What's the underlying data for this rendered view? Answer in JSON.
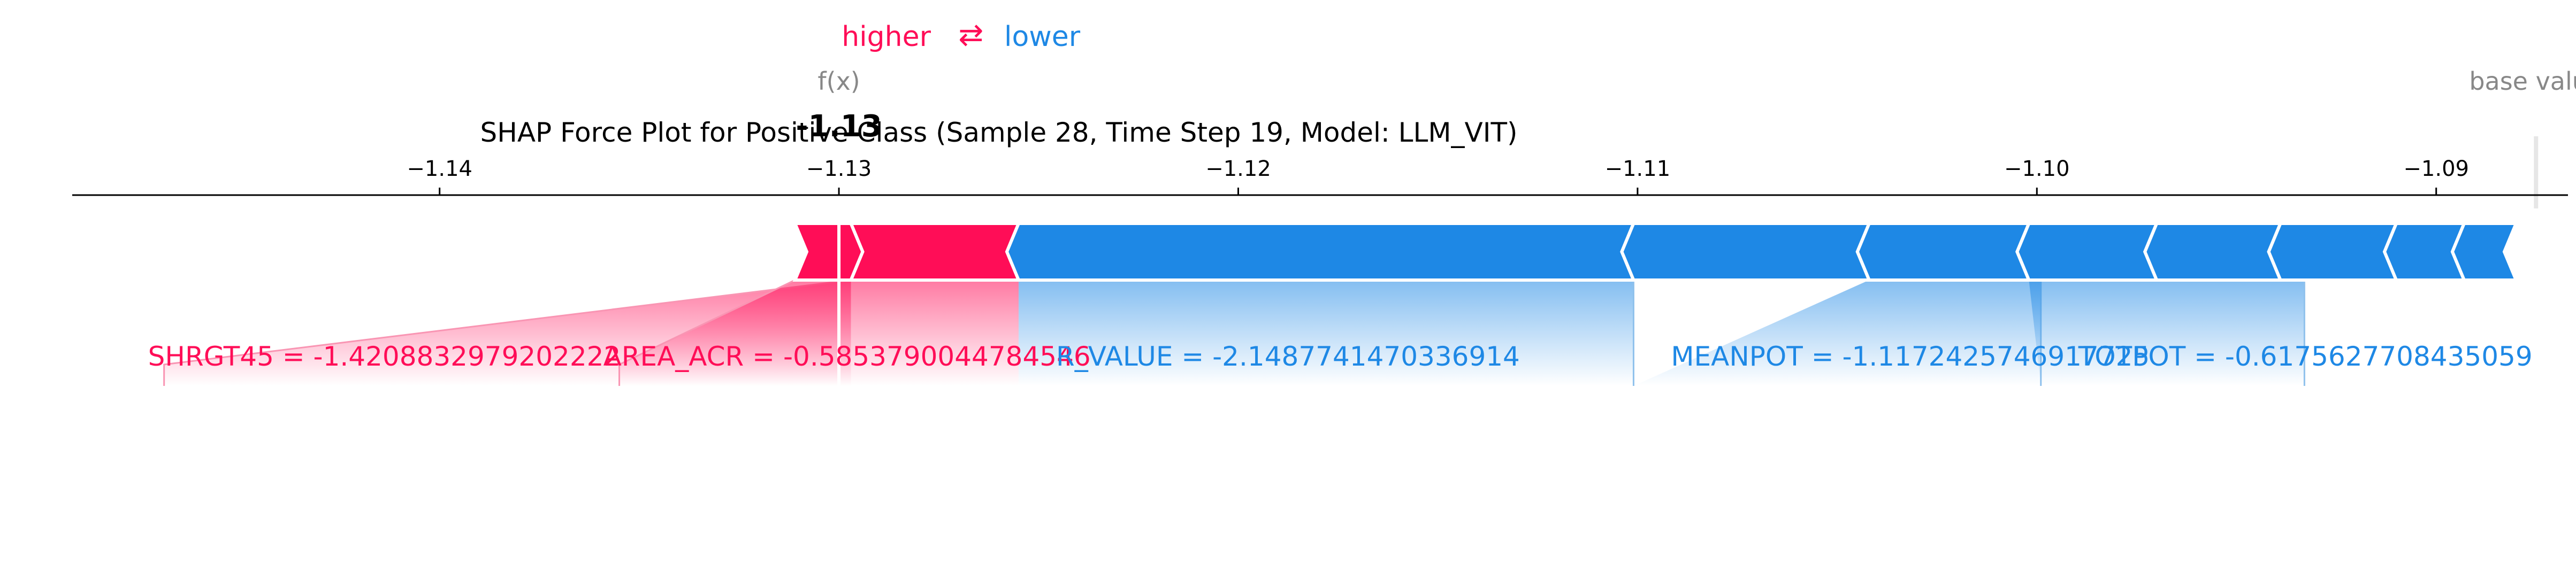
{
  "chart_data": {
    "type": "force",
    "title": "SHAP Force Plot for Positive Class (Sample 28, Time Step 19, Model: LLM_VIT)",
    "legend": {
      "higher": "higher",
      "arrow": "⇄",
      "lower": "lower"
    },
    "fx_label": "f(x)",
    "fx_value": -1.13,
    "fx_value_label": "-1.13",
    "base_value_label": "base value",
    "base_value": -1.0875,
    "xlim": [
      -1.1492,
      -1.0867
    ],
    "ticks": [
      {
        "value": -1.14,
        "label": "−1.14"
      },
      {
        "value": -1.13,
        "label": "−1.13"
      },
      {
        "value": -1.12,
        "label": "−1.12"
      },
      {
        "value": -1.11,
        "label": "−1.11"
      },
      {
        "value": -1.1,
        "label": "−1.10"
      },
      {
        "value": -1.09,
        "label": "−1.09"
      }
    ],
    "positive_segments": [
      {
        "from": -1.1297,
        "to": -1.1255
      },
      {
        "from": -1.1311,
        "to": -1.1297
      }
    ],
    "negative_segments": [
      {
        "from": -1.1255,
        "to": -1.1101
      },
      {
        "from": -1.1101,
        "to": -1.1042
      },
      {
        "from": -1.1042,
        "to": -1.1002
      },
      {
        "from": -1.1002,
        "to": -1.097
      },
      {
        "from": -1.097,
        "to": -1.0939
      },
      {
        "from": -1.0939,
        "to": -1.091
      },
      {
        "from": -1.091,
        "to": -1.0893
      },
      {
        "from": -1.0893,
        "to": -1.088
      }
    ],
    "features": [
      {
        "label": "SHRGT45 = -1.4208832979202222",
        "side": "higher",
        "from": -1.1297,
        "to": -1.1255,
        "label_x": -1.1469
      },
      {
        "label": "AREA_ACR = -0.5853790044784546",
        "side": "higher",
        "from": -1.1311,
        "to": -1.1297,
        "label_x": -1.1355
      },
      {
        "label": "R_VALUE = -2.1487741470336914",
        "side": "lower",
        "from": -1.1255,
        "to": -1.1101,
        "label_x": -1.1255
      },
      {
        "label": "MEANPOT = -1.1172425746917725",
        "side": "lower",
        "from": -1.1042,
        "to": -1.0999,
        "label_x": -1.1101
      },
      {
        "label": "TOTPOT = -0.6175627708435059",
        "side": "lower",
        "from": -1.1002,
        "to": -1.0933,
        "label_x": -1.0999
      }
    ],
    "colors": {
      "higher": "#ff0d57",
      "lower": "#1e88e5",
      "higher_light": "#f995b3",
      "lower_light": "#8fc1ec",
      "axis": "#000000",
      "muted": "#888888",
      "baseline": "#e6e6e6"
    }
  }
}
